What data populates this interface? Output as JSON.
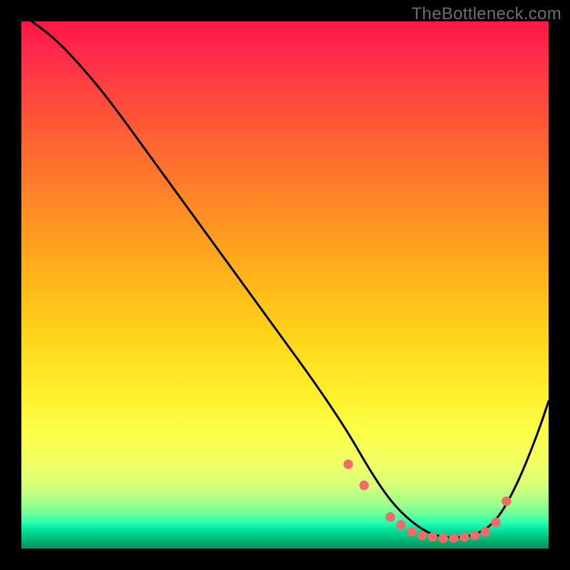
{
  "watermark": "TheBottleneck.com",
  "chart_data": {
    "type": "line",
    "title": "",
    "xlabel": "",
    "ylabel": "",
    "xlim": [
      0,
      100
    ],
    "ylim": [
      0,
      100
    ],
    "grid": false,
    "legend": false,
    "series": [
      {
        "name": "curve",
        "stroke": "#000000",
        "x": [
          2,
          6,
          10,
          16,
          24,
          32,
          40,
          48,
          56,
          62,
          66,
          70,
          74,
          78,
          82,
          86,
          90,
          94,
          98,
          100
        ],
        "y": [
          100,
          97,
          93,
          86,
          75,
          64,
          53,
          42,
          31,
          22,
          15,
          9,
          5,
          2.5,
          2,
          2.5,
          5,
          12,
          22,
          28
        ]
      }
    ],
    "markers": {
      "name": "dots",
      "color": "#f26a6a",
      "radius_pct": 0.9,
      "x": [
        62,
        65,
        70,
        72,
        74,
        76,
        78,
        80,
        82,
        84,
        86,
        88,
        90,
        92
      ],
      "y": [
        16,
        12,
        6,
        4.5,
        3.2,
        2.5,
        2.2,
        2,
        2,
        2.2,
        2.5,
        3.2,
        5,
        9
      ]
    }
  },
  "colors": {
    "marker": "#f26a6a",
    "curve": "#000000",
    "frame": "#000000"
  }
}
